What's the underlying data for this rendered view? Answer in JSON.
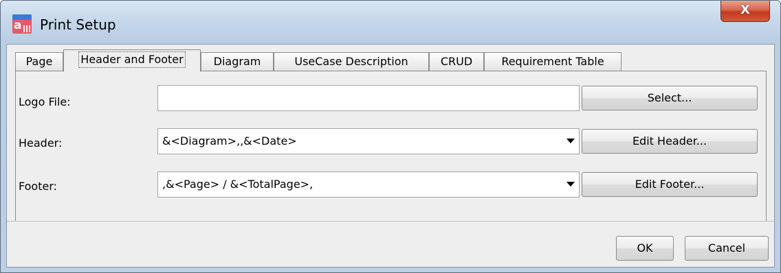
{
  "window": {
    "title": "Print Setup",
    "close_glyph": "X",
    "app_icon": "astah-app-icon",
    "app_icon_letter": "a"
  },
  "tabs": [
    {
      "label": "Page",
      "active": false
    },
    {
      "label": "Header and Footer",
      "active": true
    },
    {
      "label": "Diagram",
      "active": false
    },
    {
      "label": "UseCase Description",
      "active": false
    },
    {
      "label": "CRUD",
      "active": false
    },
    {
      "label": "Requirement Table",
      "active": false
    }
  ],
  "form": {
    "logo": {
      "label": "Logo File:",
      "value": "",
      "button": "Select..."
    },
    "header": {
      "label": "Header:",
      "value": "&<Diagram>,,&<Date>",
      "button": "Edit Header..."
    },
    "footer": {
      "label": "Footer:",
      "value": ",&<Page> / &<TotalPage>,",
      "button": "Edit Footer..."
    }
  },
  "buttons": {
    "ok": "OK",
    "cancel": "Cancel"
  },
  "colors": {
    "titlebar": "#c6d7ea",
    "close": "#c2391e",
    "dialog_bg": "#eeeeee"
  }
}
